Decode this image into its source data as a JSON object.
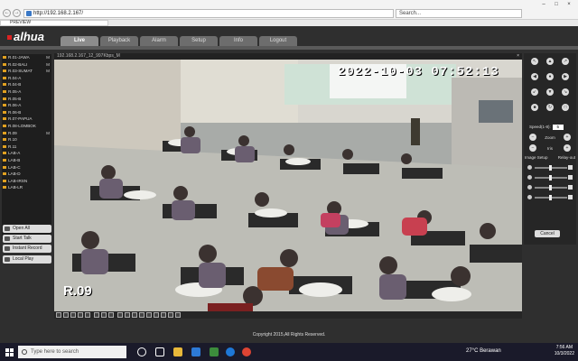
{
  "browser": {
    "url": "http://192.168.2.167/",
    "search_placeholder": "Search...",
    "tab_title": "PREVIEW"
  },
  "app": {
    "logo": "alhua",
    "tabs": [
      "Live",
      "Playback",
      "Alarm",
      "Setup",
      "Info",
      "Logout"
    ],
    "active_tab": "Live",
    "copyright": "Copyright 2015,All Rights Reserved."
  },
  "channels": [
    {
      "name": "R.01-JAWA",
      "mark": "M"
    },
    {
      "name": "R.02-BALI",
      "mark": "M"
    },
    {
      "name": "R.03-SUMAT",
      "mark": "M"
    },
    {
      "name": "R.04-A",
      "mark": ""
    },
    {
      "name": "R.04-B",
      "mark": ""
    },
    {
      "name": "R.05-A",
      "mark": ""
    },
    {
      "name": "R.05-B",
      "mark": ""
    },
    {
      "name": "R.06-A",
      "mark": ""
    },
    {
      "name": "R.06-B",
      "mark": ""
    },
    {
      "name": "R.07-PAPUA",
      "mark": ""
    },
    {
      "name": "R.08-LOMBOK",
      "mark": ""
    },
    {
      "name": "R.09",
      "mark": "M"
    },
    {
      "name": "R.10",
      "mark": ""
    },
    {
      "name": "R.11",
      "mark": ""
    },
    {
      "name": "LAB-A",
      "mark": ""
    },
    {
      "name": "LAB-B",
      "mark": ""
    },
    {
      "name": "LAB-C",
      "mark": ""
    },
    {
      "name": "LAB-D",
      "mark": ""
    },
    {
      "name": "LAB-IRSN",
      "mark": ""
    },
    {
      "name": "LAB-LR",
      "mark": ""
    }
  ],
  "left_buttons": [
    "Open All",
    "Start Talk",
    "Instant Record",
    "Local Play"
  ],
  "video": {
    "info": "192.168.2.167_12_997Kbps_M",
    "timestamp": "2022-10-03  07:52:13",
    "camera": "R.09"
  },
  "ptz": {
    "zoom": "Zoom",
    "focus": "Focus",
    "iris": "Iris",
    "speed_label": "Speed(1-8):",
    "speed": "5"
  },
  "image": {
    "tab1": "Image Setup",
    "tab2": "Relay-out",
    "cancel": "Cancel"
  },
  "taskbar": {
    "search": "Type here to search",
    "weather": "27°C  Berawan",
    "time": "7:56 AM",
    "date": "10/3/2022"
  }
}
